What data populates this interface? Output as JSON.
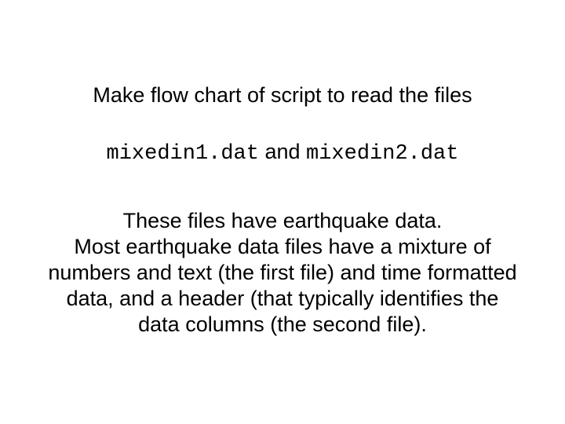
{
  "slide": {
    "title_line": "Make flow chart of script to read the files",
    "filenames": {
      "file1": "mixedin1.dat",
      "connector": " and ",
      "file2": "mixedin2.dat"
    },
    "paragraph": {
      "l1": "These files have earthquake data.",
      "l2": "Most earthquake data files have a mixture of",
      "l3": "numbers and text (the first file) and time formatted",
      "l4": "data, and a header (that typically identifies the",
      "l5": "data columns (the second file)."
    }
  }
}
